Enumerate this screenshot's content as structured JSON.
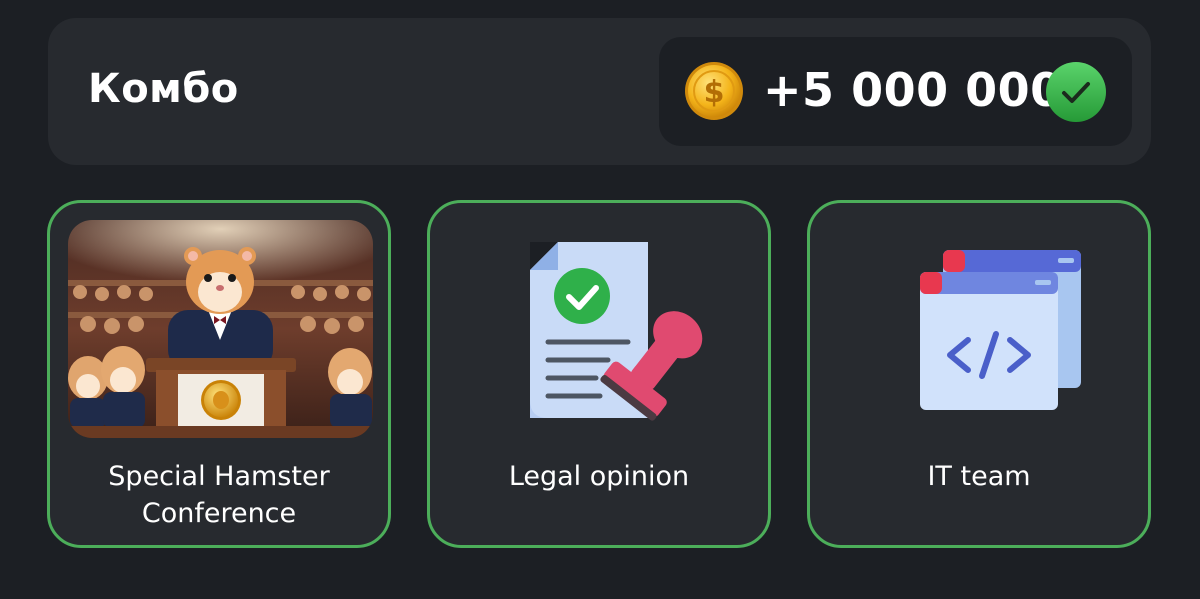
{
  "combo": {
    "title": "Комбо",
    "reward": "+5 000 000",
    "coin_icon": "dollar-coin-icon",
    "status_icon": "checkmark-icon",
    "status_color": "#3ab54a"
  },
  "cards": [
    {
      "label": "Special Hamster Conference",
      "image": "hamster-conference-image",
      "completed": true
    },
    {
      "label": "Legal opinion",
      "image": "legal-document-stamp-icon",
      "completed": true
    },
    {
      "label": "IT team",
      "image": "code-window-icon",
      "completed": true
    }
  ],
  "colors": {
    "background": "#1c1f24",
    "panel": "#272a2f",
    "accent_border": "#4cae5a"
  }
}
